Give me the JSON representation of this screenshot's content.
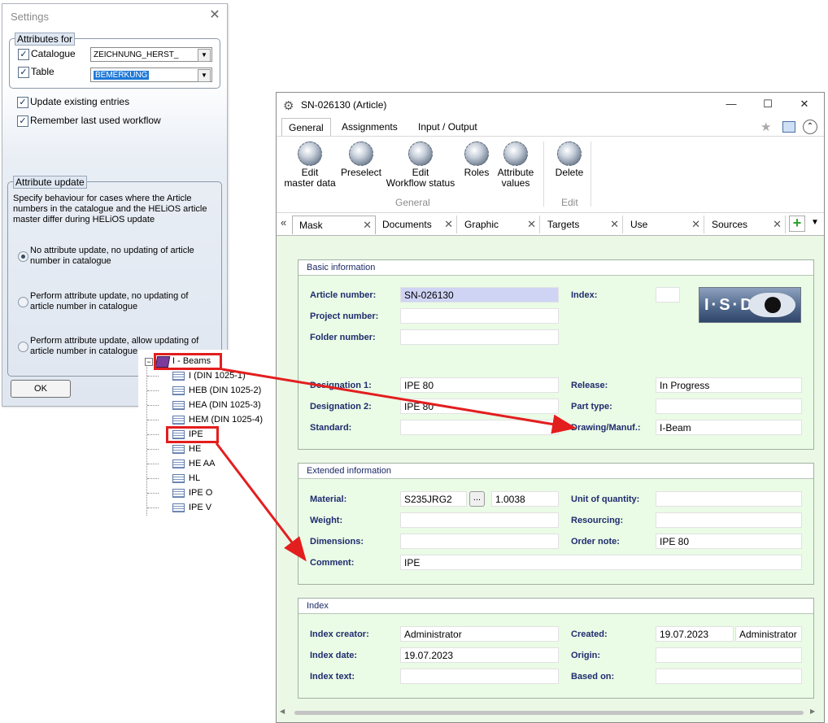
{
  "settings": {
    "title": "Settings",
    "attributes_for": {
      "legend": "Attributes for",
      "catalogue_label": "Catalogue",
      "catalogue_value": "ZEICHNUNG_HERST_",
      "table_label": "Table",
      "table_value": "BEMERKUNG"
    },
    "update_existing": "Update existing entries",
    "remember_workflow": "Remember last used workflow",
    "attribute_update": {
      "legend": "Attribute update",
      "description": "Specify behaviour for cases where the Article numbers in the catalogue and the HELiOS article master differ during HELiOS update",
      "options": [
        "No attribute update, no updating of article number in catalogue",
        "Perform attribute update, no updating of article number in catalogue",
        "Perform attribute update, allow updating of article number in catalogue"
      ]
    },
    "ok": "OK"
  },
  "tree": {
    "root": "I - Beams",
    "items": [
      "I (DIN 1025-1)",
      "HEB (DIN 1025-2)",
      "HEA (DIN 1025-3)",
      "HEM (DIN 1025-4)",
      "IPE",
      "HE",
      "HE AA",
      "HL",
      "IPE O",
      "IPE V"
    ]
  },
  "article": {
    "title": "SN-026130 (Article)",
    "window_buttons": [
      "—",
      "☐",
      "✕"
    ],
    "ribbon_tabs": [
      "General",
      "Assignments",
      "Input / Output"
    ],
    "ribbon_buttons": [
      "Edit\nmaster data",
      "Preselect",
      "Edit\nWorkflow status",
      "Roles",
      "Attribute\nvalues",
      "Delete"
    ],
    "group_general": "General",
    "group_edit": "Edit",
    "doc_tabs": [
      "Mask",
      "Documents",
      "Graphic",
      "Targets",
      "Use",
      "Sources"
    ],
    "basic": {
      "header": "Basic information",
      "article_number_label": "Article number:",
      "article_number": "SN-026130",
      "project_number_label": "Project number:",
      "folder_number_label": "Folder number:",
      "index_label": "Index:",
      "logo_text": "I·S·D",
      "designation1_label": "Designation 1:",
      "designation1": "IPE 80",
      "designation2_label": "Designation 2:",
      "designation2": "IPE 80",
      "standard_label": "Standard:",
      "release_label": "Release:",
      "release": "In Progress",
      "part_type_label": "Part type:",
      "drawing_label": "Drawing/Manuf.:",
      "drawing": "I-Beam"
    },
    "extended": {
      "header": "Extended information",
      "material_label": "Material:",
      "material": "S235JRG2",
      "material_btn": "...",
      "material_no": "1.0038",
      "weight_label": "Weight:",
      "dimensions_label": "Dimensions:",
      "comment_label": "Comment:",
      "comment": "IPE",
      "unit_label": "Unit of quantity:",
      "resourcing_label": "Resourcing:",
      "order_note_label": "Order note:",
      "order_note": "IPE 80"
    },
    "index": {
      "header": "Index",
      "creator_label": "Index creator:",
      "creator": "Administrator",
      "date_label": "Index date:",
      "date": "19.07.2023",
      "text_label": "Index text:",
      "created_label": "Created:",
      "created_date": "19.07.2023",
      "created_by": "Administrator",
      "origin_label": "Origin:",
      "based_on_label": "Based on:"
    }
  },
  "colors": {
    "highlight_red": "#e31e1e",
    "content_bg": "#ebf8e6",
    "label_blue": "#1f2c6e"
  }
}
